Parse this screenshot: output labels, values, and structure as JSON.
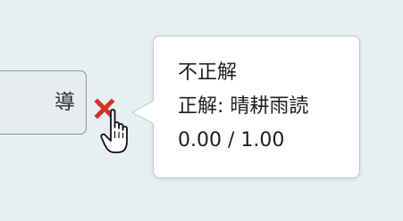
{
  "answer_field": {
    "partial_text": "導"
  },
  "result_icon": "incorrect-x-icon",
  "cursor_icon": "hand-pointer-icon",
  "colors": {
    "background": "#e6f0f3",
    "incorrect_mark": "#d93025",
    "popover_background": "#ffffff",
    "field_background": "#e9ecef"
  },
  "feedback": {
    "status": "不正解",
    "correct_answer": "正解: 晴耕雨読",
    "score": "0.00 / 1.00"
  }
}
